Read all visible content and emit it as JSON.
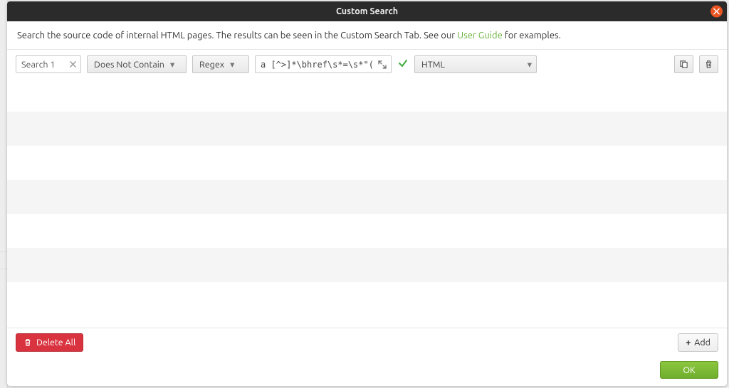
{
  "titlebar": {
    "title": "Custom Search"
  },
  "description": {
    "prefix": "Search the source code of internal HTML pages. The results can be seen in the Custom Search Tab. See our ",
    "link": "User Guide",
    "suffix": " for examples."
  },
  "rows": [
    {
      "name": "Search 1",
      "match_mode": "Does Not Contain",
      "pattern_mode": "Regex",
      "pattern": "a [^>]*\\bhref\\s*=\\s*\"(( ^\"]",
      "valid": true,
      "source": "HTML"
    }
  ],
  "footer": {
    "delete_all": "Delete All",
    "add": "Add"
  },
  "okbar": {
    "ok": "OK"
  },
  "colors": {
    "accent_green": "#6cb33f",
    "danger": "#d9333f",
    "ok_button": "#7fbf33",
    "titlebar_close": "#e95420"
  }
}
